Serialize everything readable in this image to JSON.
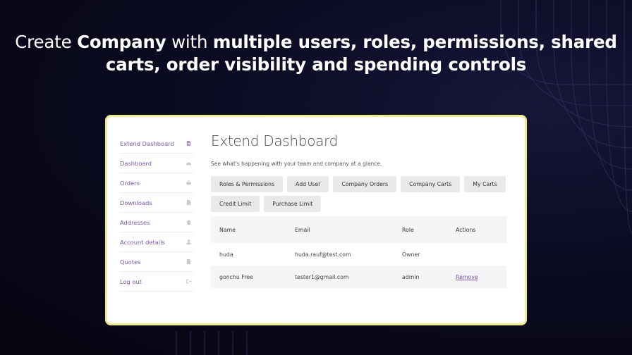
{
  "headline": {
    "part1": "Create ",
    "part2": "Company",
    "part3": " with ",
    "part4": "multiple users, roles, permissions, shared carts, order visibility and spending controls"
  },
  "sidebar": {
    "items": [
      {
        "label": "Extend Dashboard",
        "icon": "document-icon"
      },
      {
        "label": "Dashboard",
        "icon": "gauge-icon"
      },
      {
        "label": "Orders",
        "icon": "basket-icon"
      },
      {
        "label": "Downloads",
        "icon": "file-icon"
      },
      {
        "label": "Addresses",
        "icon": "home-icon"
      },
      {
        "label": "Account details",
        "icon": "user-icon"
      },
      {
        "label": "Quotes",
        "icon": "file-icon"
      },
      {
        "label": "Log out",
        "icon": "logout-icon"
      }
    ]
  },
  "main": {
    "title": "Extend Dashboard",
    "subtitle": "See what's happening with your team and company at a glance.",
    "buttons": [
      "Roles & Permissions",
      "Add User",
      "Company Orders",
      "Company Carts",
      "My Carts",
      "Credit Limit",
      "Purchase Limit"
    ]
  },
  "table": {
    "headers": [
      "Name",
      "Email",
      "Role",
      "Actions"
    ],
    "rows": [
      {
        "name": "huda",
        "email": "huda.rauf@test.com",
        "role": "Owner",
        "action": ""
      },
      {
        "name": "gonchu Free",
        "email": "tester1@gmail.com",
        "role": "admin",
        "action": "Remove"
      }
    ]
  },
  "colors": {
    "background": "#0b0b22",
    "card_border": "#f1ea8a",
    "accent": "#7b56a8"
  }
}
